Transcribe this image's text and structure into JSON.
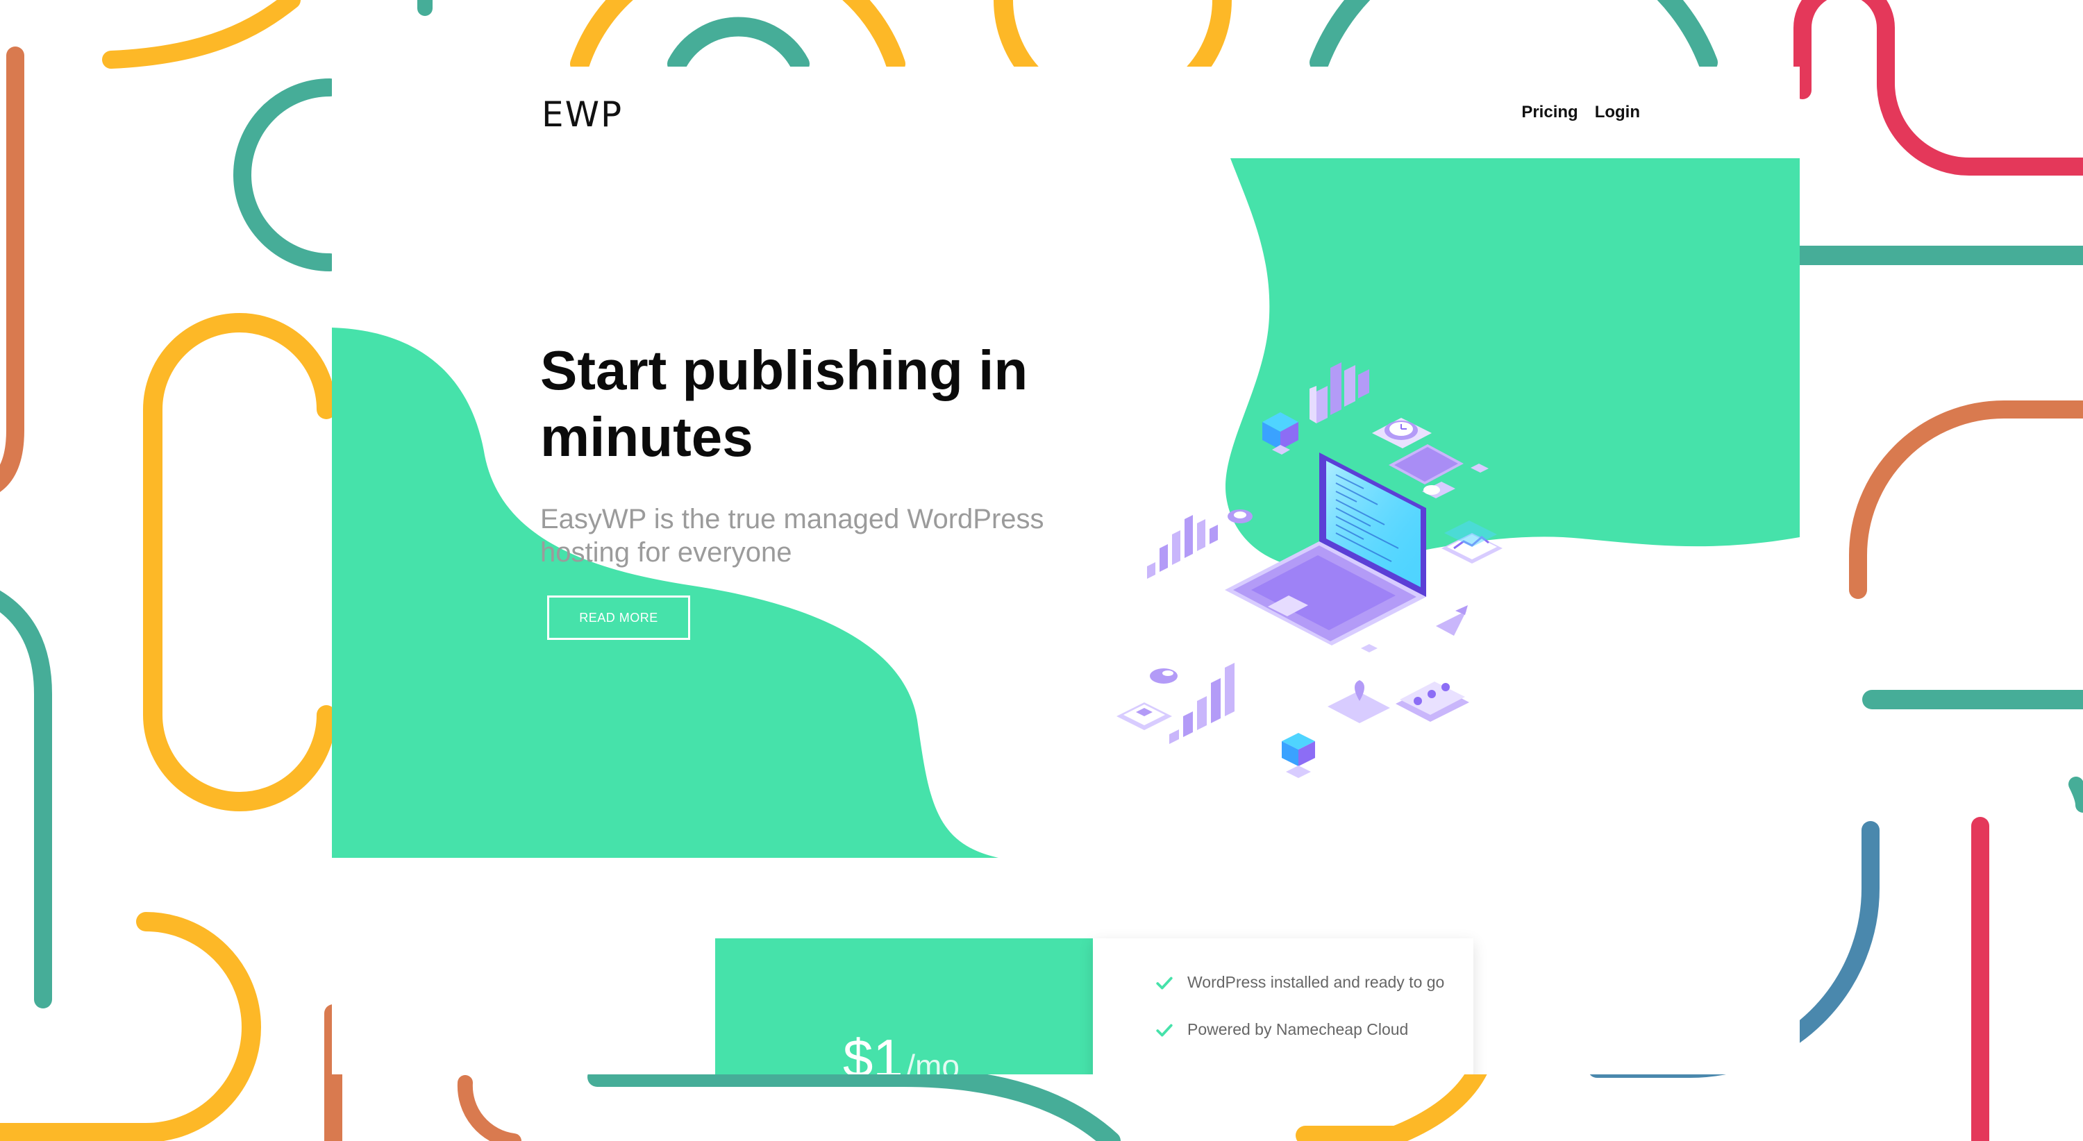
{
  "brand": {
    "logo": "EWP"
  },
  "nav": {
    "items": [
      "Pricing",
      "Login"
    ]
  },
  "hero": {
    "title": "Start publishing in minutes",
    "subtitle": "EasyWP is the true managed WordPress hosting for everyone",
    "cta_label": "READ MORE"
  },
  "pricing": {
    "amount": "$1",
    "unit": "/mo"
  },
  "features": [
    "WordPress installed and ready to go",
    "Powered by Namecheap Cloud"
  ],
  "colors": {
    "accent": "#46e2aa",
    "teal": "#46ad98",
    "yellow": "#fdb827",
    "orange": "#d97a4f",
    "red": "#e4385a",
    "blue": "#4a88ad",
    "purple": "#9b7cf6"
  },
  "icons": [
    "check-icon",
    "laptop-illustration"
  ]
}
